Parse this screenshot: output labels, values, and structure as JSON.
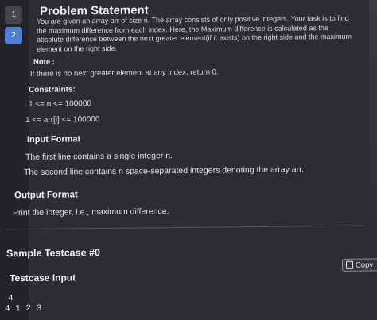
{
  "sidebar": {
    "questions": [
      "1",
      "2"
    ],
    "active": "2"
  },
  "problem": {
    "title": "Problem Statement",
    "description": "You are given an array arr of size n. The array consists of only positive integers. Your task is to find the maximum difference from each index. Here, the Maximum difference is calculated as the absolute difference between the next greater element(if it exists) on the right side and the maximum element on the right side.",
    "note_label": "Note :",
    "note_text": "If there is no next greater element at any index, return 0.",
    "constraints_label": "Constraints:",
    "constraints": [
      "1 <= n <= 100000",
      "1 <= arr[i] <= 100000"
    ],
    "input_format_label": "Input Format",
    "input_format_lines": [
      "The first line contains a single integer n.",
      "The second line contains n space-separated integers denoting the array arr."
    ],
    "output_format_label": "Output Format",
    "output_format_text": "Print the integer, i.e., maximum difference."
  },
  "sample": {
    "label": "Sample Testcase #0",
    "input_label": "Testcase Input",
    "copy_label": "Copy",
    "input_lines": [
      "4",
      "4 1 2 3"
    ]
  },
  "colors": {
    "background": "#2c2d31",
    "active_question": "#4f7fd6"
  }
}
